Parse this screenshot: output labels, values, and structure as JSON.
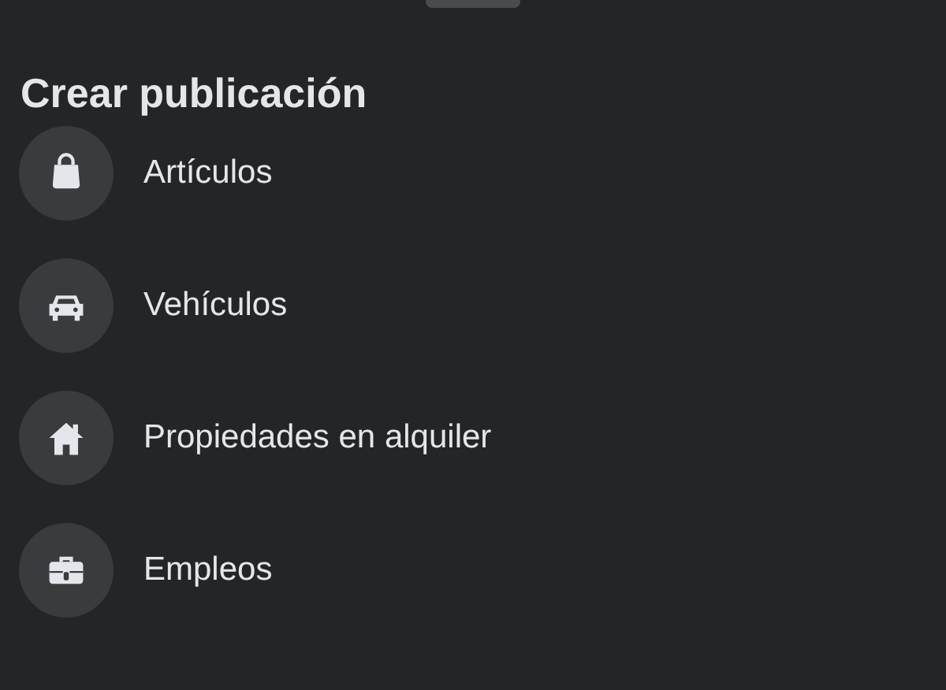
{
  "title": "Crear publicación",
  "items": [
    {
      "kind": "bag",
      "label": "Artículos"
    },
    {
      "kind": "car",
      "label": "Vehículos"
    },
    {
      "kind": "house",
      "label": "Propiedades en alquiler"
    },
    {
      "kind": "briefcase",
      "label": "Empleos"
    }
  ]
}
